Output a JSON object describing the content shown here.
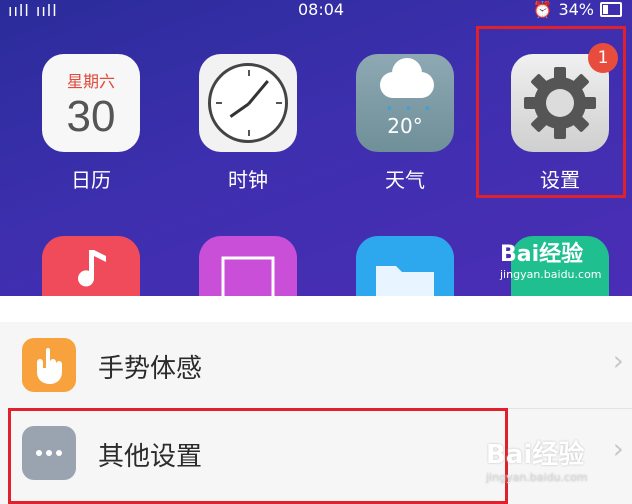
{
  "status_bar": {
    "signal": "ııll ııll",
    "time": "08:04",
    "battery": "34%"
  },
  "apps_row1": [
    {
      "label": "日历",
      "weekday": "星期六",
      "day": "30"
    },
    {
      "label": "时钟"
    },
    {
      "label": "天气",
      "temp": "20°"
    },
    {
      "label": "设置",
      "badge": "1"
    }
  ],
  "watermark": {
    "brand": "Bai经验",
    "url": "jingyan.baidu.com"
  },
  "settings_list": [
    {
      "label": "手势体感",
      "icon": "hand-gesture-icon",
      "color": "#f7a23c"
    },
    {
      "label": "其他设置",
      "icon": "more-dots-icon",
      "color": "#9aa3b0"
    }
  ],
  "colors": {
    "highlight": "#e0202a",
    "badge": "#e74c3c"
  }
}
